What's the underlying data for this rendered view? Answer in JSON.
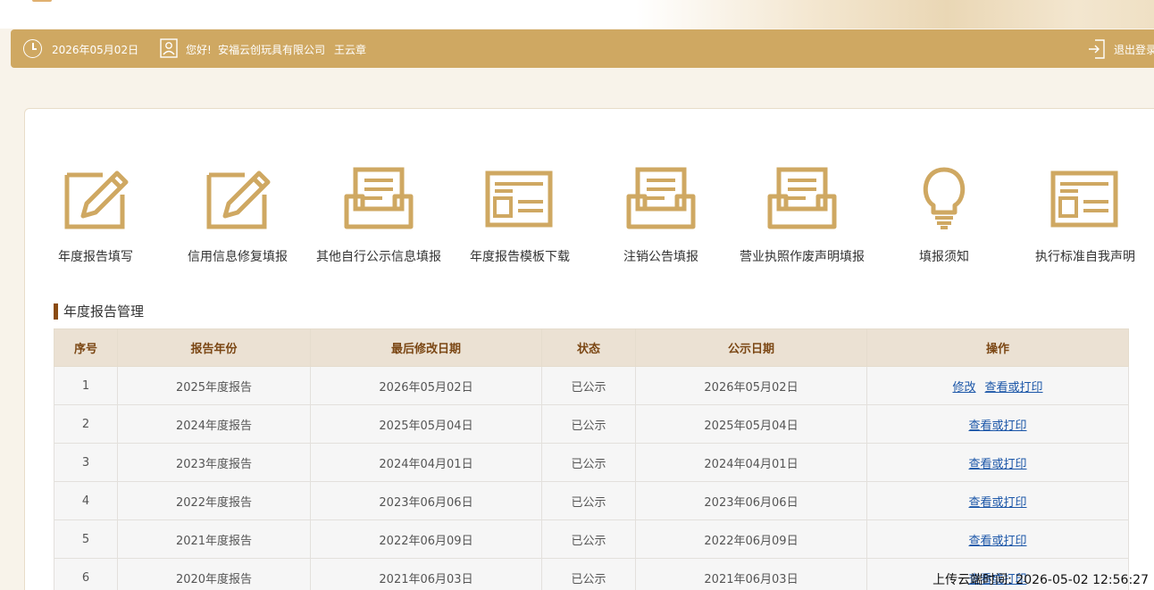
{
  "header": {
    "date": "2026年05月02日",
    "greeting": "您好!",
    "company": "安福云创玩具有限公司",
    "username": "王云章",
    "logout_label": "退出登录"
  },
  "tiles": [
    {
      "label": "年度报告填写",
      "icon": "pencil-edit-icon"
    },
    {
      "label": "信用信息修复填报",
      "icon": "pencil-edit-icon"
    },
    {
      "label": "其他自行公示信息填报",
      "icon": "inbox-tray-icon"
    },
    {
      "label": "年度报告模板下载",
      "icon": "template-document-icon"
    },
    {
      "label": "注销公告填报",
      "icon": "inbox-tray-icon"
    },
    {
      "label": "营业执照作废声明填报",
      "icon": "inbox-tray-icon"
    },
    {
      "label": "填报须知",
      "icon": "lightbulb-icon"
    },
    {
      "label": "执行标准自我声明",
      "icon": "template-document-icon"
    }
  ],
  "section_title": "年度报告管理",
  "table": {
    "headers": [
      "序号",
      "报告年份",
      "最后修改日期",
      "状态",
      "公示日期",
      "操作"
    ],
    "rows": [
      {
        "no": "1",
        "year": "2025年度报告",
        "modified": "2026年05月02日",
        "status": "已公示",
        "published": "2026年05月02日",
        "actions": [
          "修改",
          "查看或打印"
        ]
      },
      {
        "no": "2",
        "year": "2024年度报告",
        "modified": "2025年05月04日",
        "status": "已公示",
        "published": "2025年05月04日",
        "actions": [
          "查看或打印"
        ]
      },
      {
        "no": "3",
        "year": "2023年度报告",
        "modified": "2024年04月01日",
        "status": "已公示",
        "published": "2024年04月01日",
        "actions": [
          "查看或打印"
        ]
      },
      {
        "no": "4",
        "year": "2022年度报告",
        "modified": "2023年06月06日",
        "status": "已公示",
        "published": "2023年06月06日",
        "actions": [
          "查看或打印"
        ]
      },
      {
        "no": "5",
        "year": "2021年度报告",
        "modified": "2022年06月09日",
        "status": "已公示",
        "published": "2022年06月09日",
        "actions": [
          "查看或打印"
        ]
      },
      {
        "no": "6",
        "year": "2020年度报告",
        "modified": "2021年06月03日",
        "status": "已公示",
        "published": "2021年06月03日",
        "actions": [
          "查看或打印"
        ]
      }
    ]
  },
  "upload_timestamp": "上传云端时间: 2026-05-02 12:56:27",
  "colors": {
    "accent": "#cfa862",
    "header_text": "#7b4714",
    "link": "#1b56a8",
    "section_mark": "#8a4b11"
  }
}
